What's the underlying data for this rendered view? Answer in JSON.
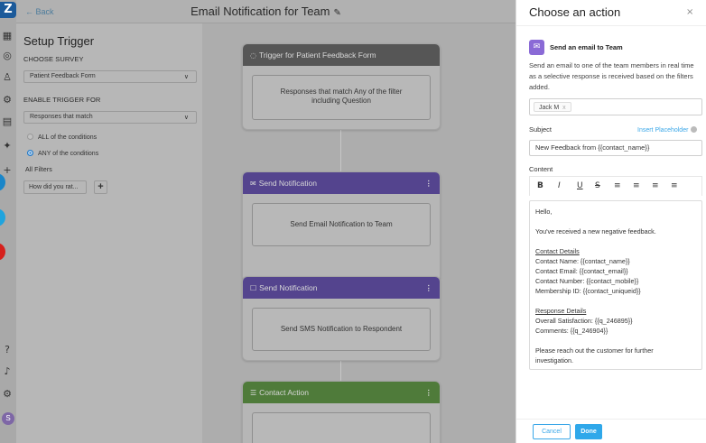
{
  "header": {
    "back_label": "← Back",
    "title": "Email Notification for Team",
    "edit_icon": "pencil-icon"
  },
  "rail": {
    "logo_icon": "logo-icon",
    "icons": [
      "grid-icon",
      "analytics-icon",
      "user-icon",
      "settings-icon",
      "document-icon",
      "person-icon",
      "add-icon",
      "help-icon",
      "bell-icon",
      "gear-icon"
    ],
    "avatar_letter": "S",
    "status_colors": [
      "#1a86c9",
      "#1fa4de",
      "#d6201c"
    ]
  },
  "trigger": {
    "heading": "Setup Trigger",
    "choose_survey_label": "CHOOSE SURVEY",
    "survey_value": "Patient Feedback Form",
    "enable_label": "ENABLE TRIGGER FOR",
    "enable_value": "Responses that match",
    "radio_all": "ALL of the conditions",
    "radio_any": "ANY of the conditions",
    "filters_label": "All Filters",
    "filter_chip": "How did you rat...",
    "add_filter_label": "+"
  },
  "canvas": {
    "nodes": [
      {
        "header": "Trigger for Patient Feedback Form",
        "body": "Responses that match Any of the filter including Question",
        "icon": "trigger-icon",
        "color": "dark"
      },
      {
        "header": "Send Notification",
        "body": "Send Email Notification to Team",
        "icon": "mail-icon",
        "color": "purple"
      },
      {
        "header": "Send Notification",
        "body": "Send SMS Notification to Respondent",
        "icon": "sms-icon",
        "color": "purple"
      },
      {
        "header": "Contact Action",
        "body": "",
        "icon": "list-icon",
        "color": "green"
      }
    ],
    "kebab": "⋮"
  },
  "drawer": {
    "title": "Choose an action",
    "close": "×",
    "action_title": "Send an email to Team",
    "action_desc": "Send an email to one of the team members in real time as a selective response is received based on the filters added.",
    "recipient_tag": "Jack M",
    "recipient_remove": "x",
    "subject_label": "Subject",
    "insert_placeholder": "Insert Placeholder",
    "subject_value": "New Feedback from {{contact_name}}",
    "content_label": "Content",
    "toolbar": [
      "B",
      "I",
      "U",
      "S",
      "≡",
      "≡",
      "≡",
      "≡"
    ],
    "content": {
      "greeting": "Hello,",
      "intro": "You've received a new negative feedback.",
      "contact_heading": "Contact Details",
      "contact_lines": [
        "Contact Name: {{contact_name}}",
        "Contact Email: {{contact_email}}",
        "Contact Number: {{contact_mobile}}",
        "Membership ID: {{contact_uniqueid}}"
      ],
      "response_heading": "Response Details",
      "response_lines": [
        "Overall Satisfaction: {{q_246895}}",
        "Comments: {{q_246904}}"
      ],
      "closing": [
        "Please reach out the customer for further",
        "investigation."
      ]
    },
    "cancel_label": "Cancel",
    "done_label": "Done"
  }
}
